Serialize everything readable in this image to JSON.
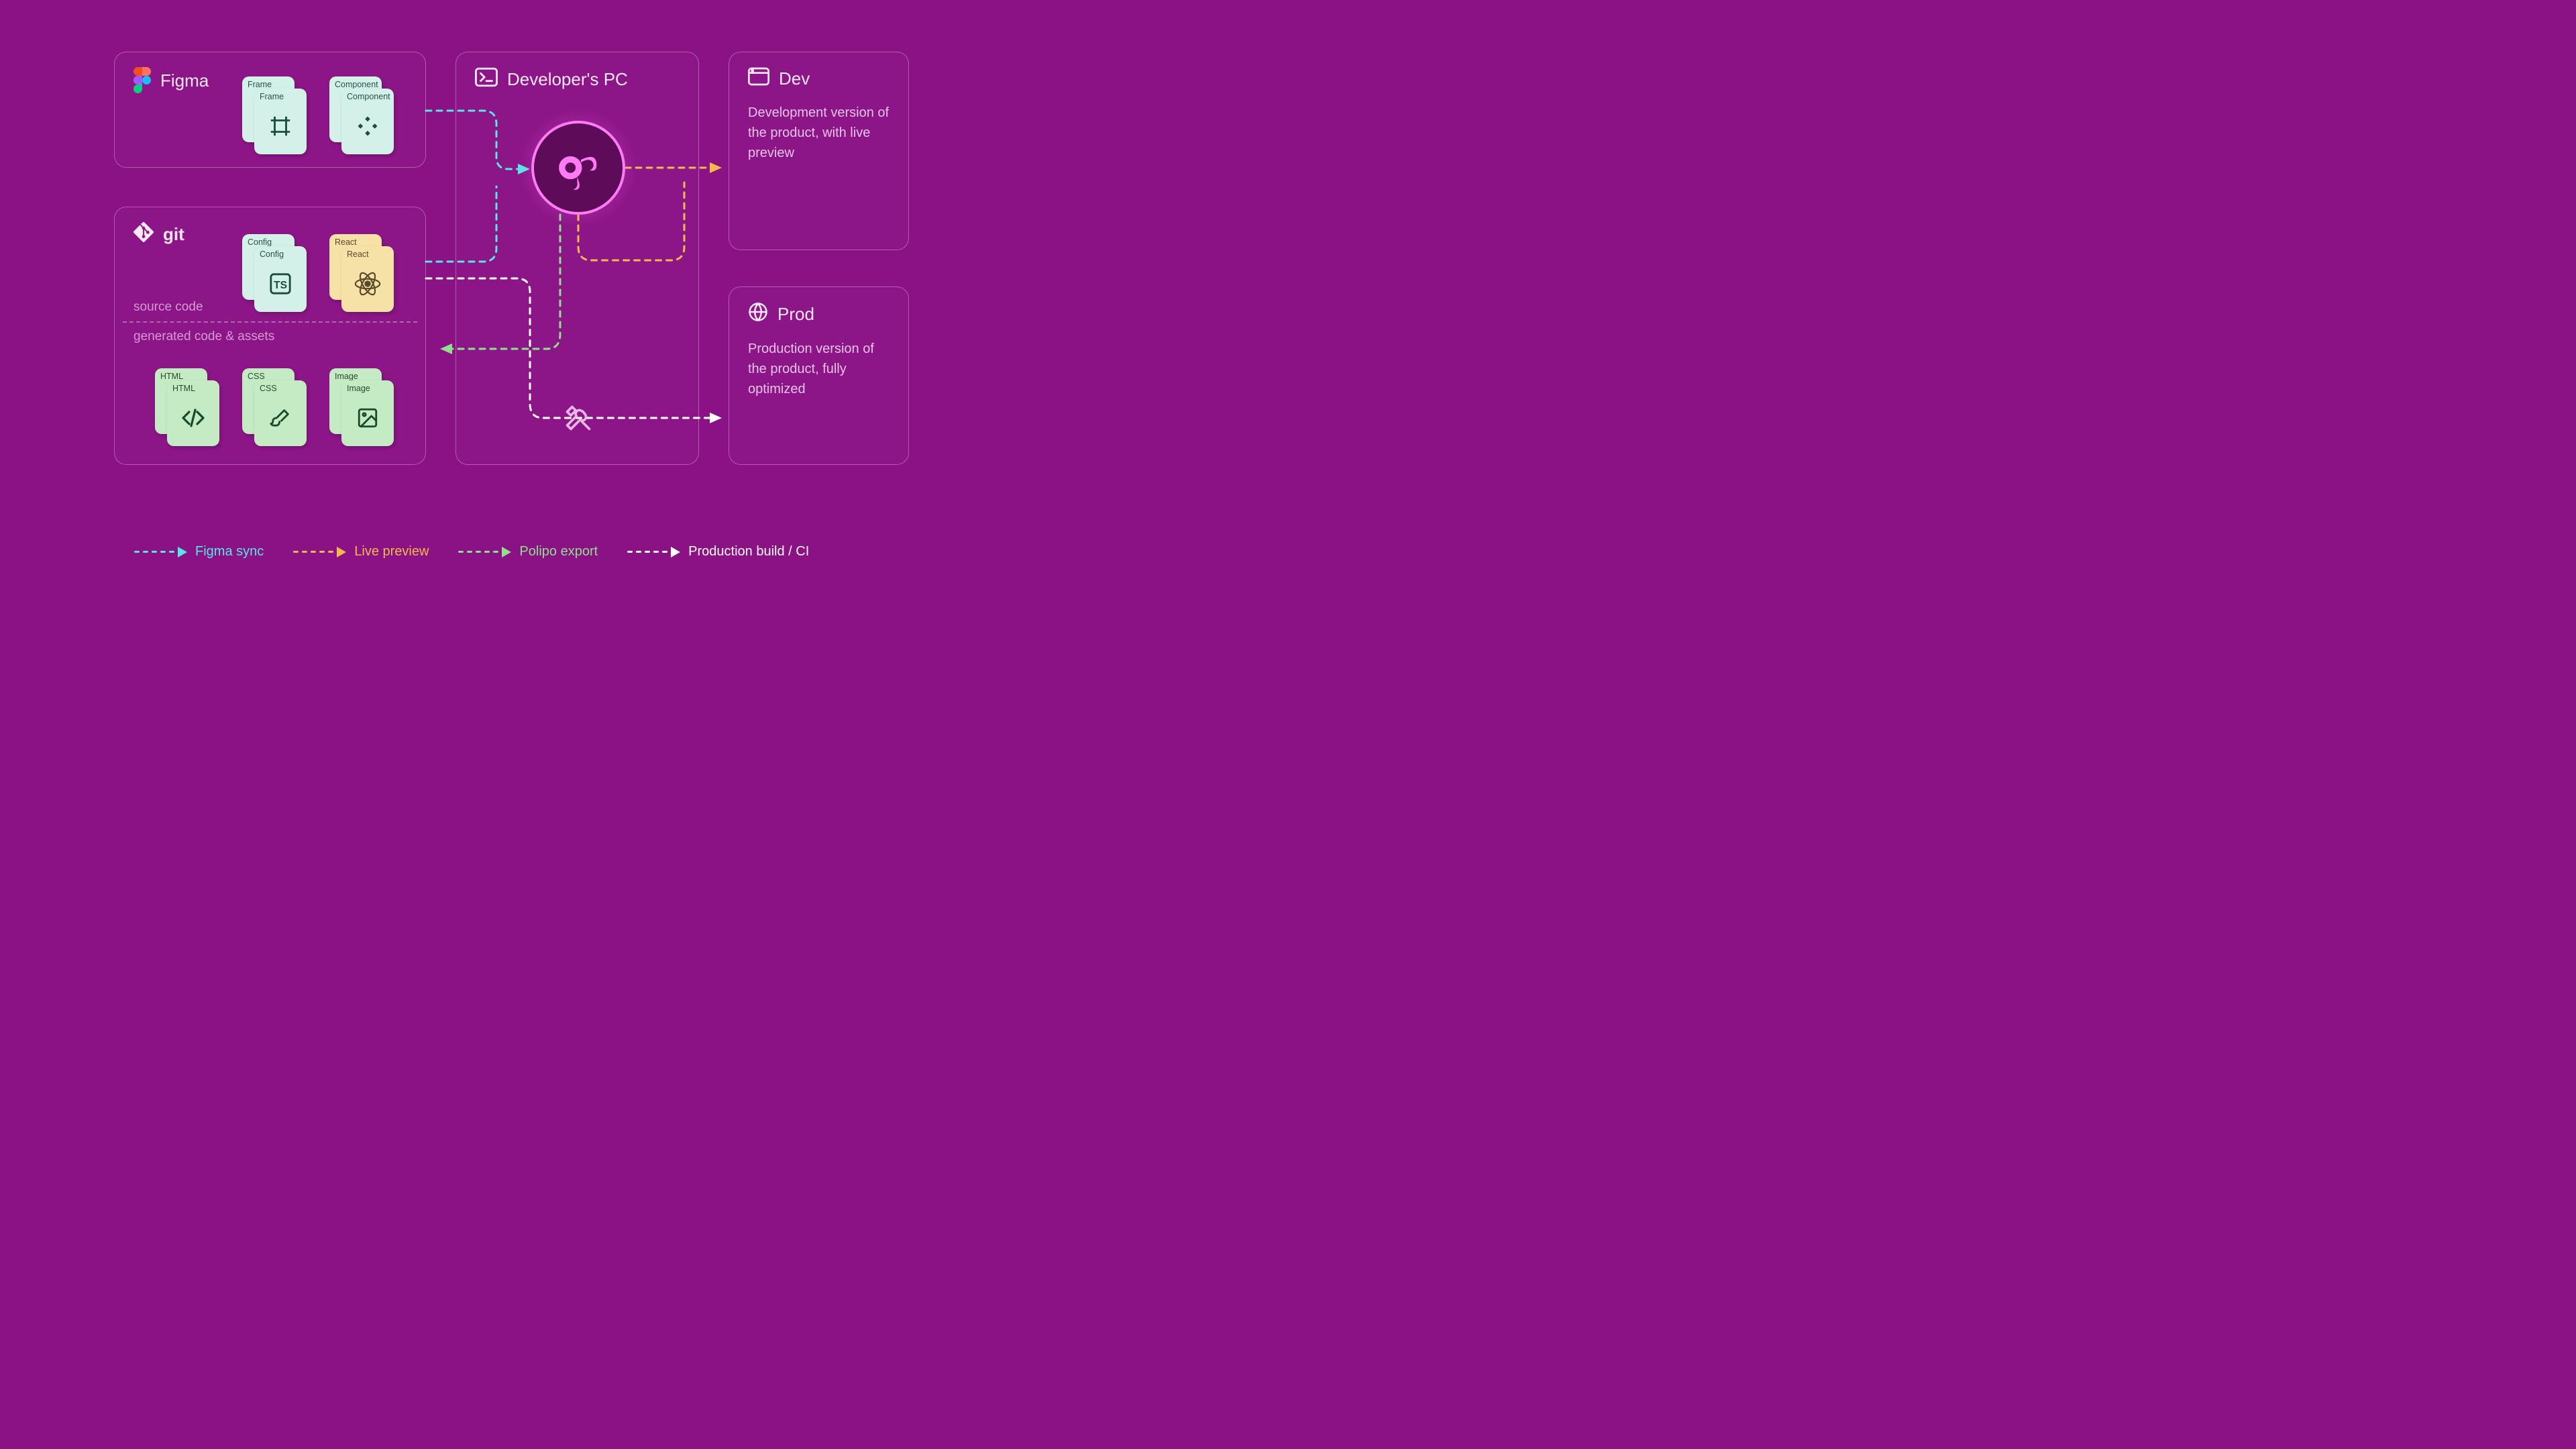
{
  "panels": {
    "figma": {
      "title": "Figma",
      "files": {
        "frame": "Frame",
        "component": "Component"
      }
    },
    "git": {
      "title": "git",
      "section_source": "source code",
      "section_generated": "generated code & assets",
      "files": {
        "config": "Config",
        "react": "React",
        "html": "HTML",
        "css": "CSS",
        "image": "Image"
      }
    },
    "dev_pc": {
      "title": "Developer's PC"
    },
    "dev": {
      "title": "Dev",
      "desc": "Development version of the product, with live preview"
    },
    "prod": {
      "title": "Prod",
      "desc": "Production version of the product, fully optimized"
    }
  },
  "legend": {
    "figma_sync": "Figma sync",
    "live_preview": "Live preview",
    "polipo_export": "Polipo export",
    "production_build": "Production build / CI"
  },
  "colors": {
    "cyan": "#57e6e6",
    "amber": "#f3b94a",
    "green": "#8fe08f",
    "white": "#ffffff"
  }
}
